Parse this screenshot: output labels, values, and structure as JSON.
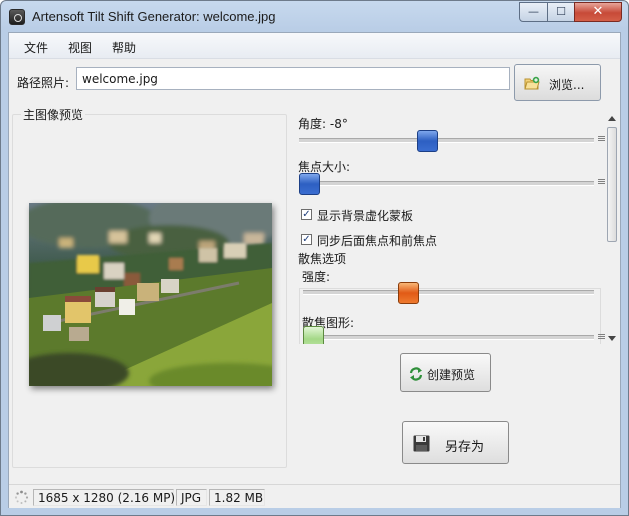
{
  "window": {
    "title": "Artensoft Tilt Shift Generator: welcome.jpg",
    "close_glyph": "✕",
    "min_glyph": "—",
    "max_glyph": "☐"
  },
  "menu": [
    "文件",
    "视图",
    "帮助"
  ],
  "path": {
    "label": "路径照片:",
    "value": "welcome.jpg",
    "browse_label": "浏览..."
  },
  "preview": {
    "title": "主图像预览"
  },
  "options": {
    "angle_label": "角度: -8°",
    "angle_slider": 0.43,
    "focus_label": "焦点大小:",
    "focus_slider": 0.0,
    "checkbox_mask": {
      "label": "显示背景虚化蒙板",
      "checked": true
    },
    "checkbox_sync": {
      "label": "同步后面焦点和前焦点",
      "checked": true
    },
    "bokeh_group_title": "散焦选项",
    "strength_label": "强度:",
    "strength_slider": 0.35,
    "shape_label": "散焦图形:",
    "shape_slider": 0.0,
    "check_glyph": "✓"
  },
  "buttons": {
    "create_preview": "创建预览",
    "save_as": "另存为"
  },
  "status": {
    "dimensions": "1685 x 1280 (2.16 MP)",
    "format": "JPG",
    "size": "1.82 MB"
  },
  "colors": {
    "slider_blue": "#2d5fc2",
    "slider_orange": "#e15a16",
    "slider_green": "#a4d887",
    "close_red": "#c74a38"
  }
}
